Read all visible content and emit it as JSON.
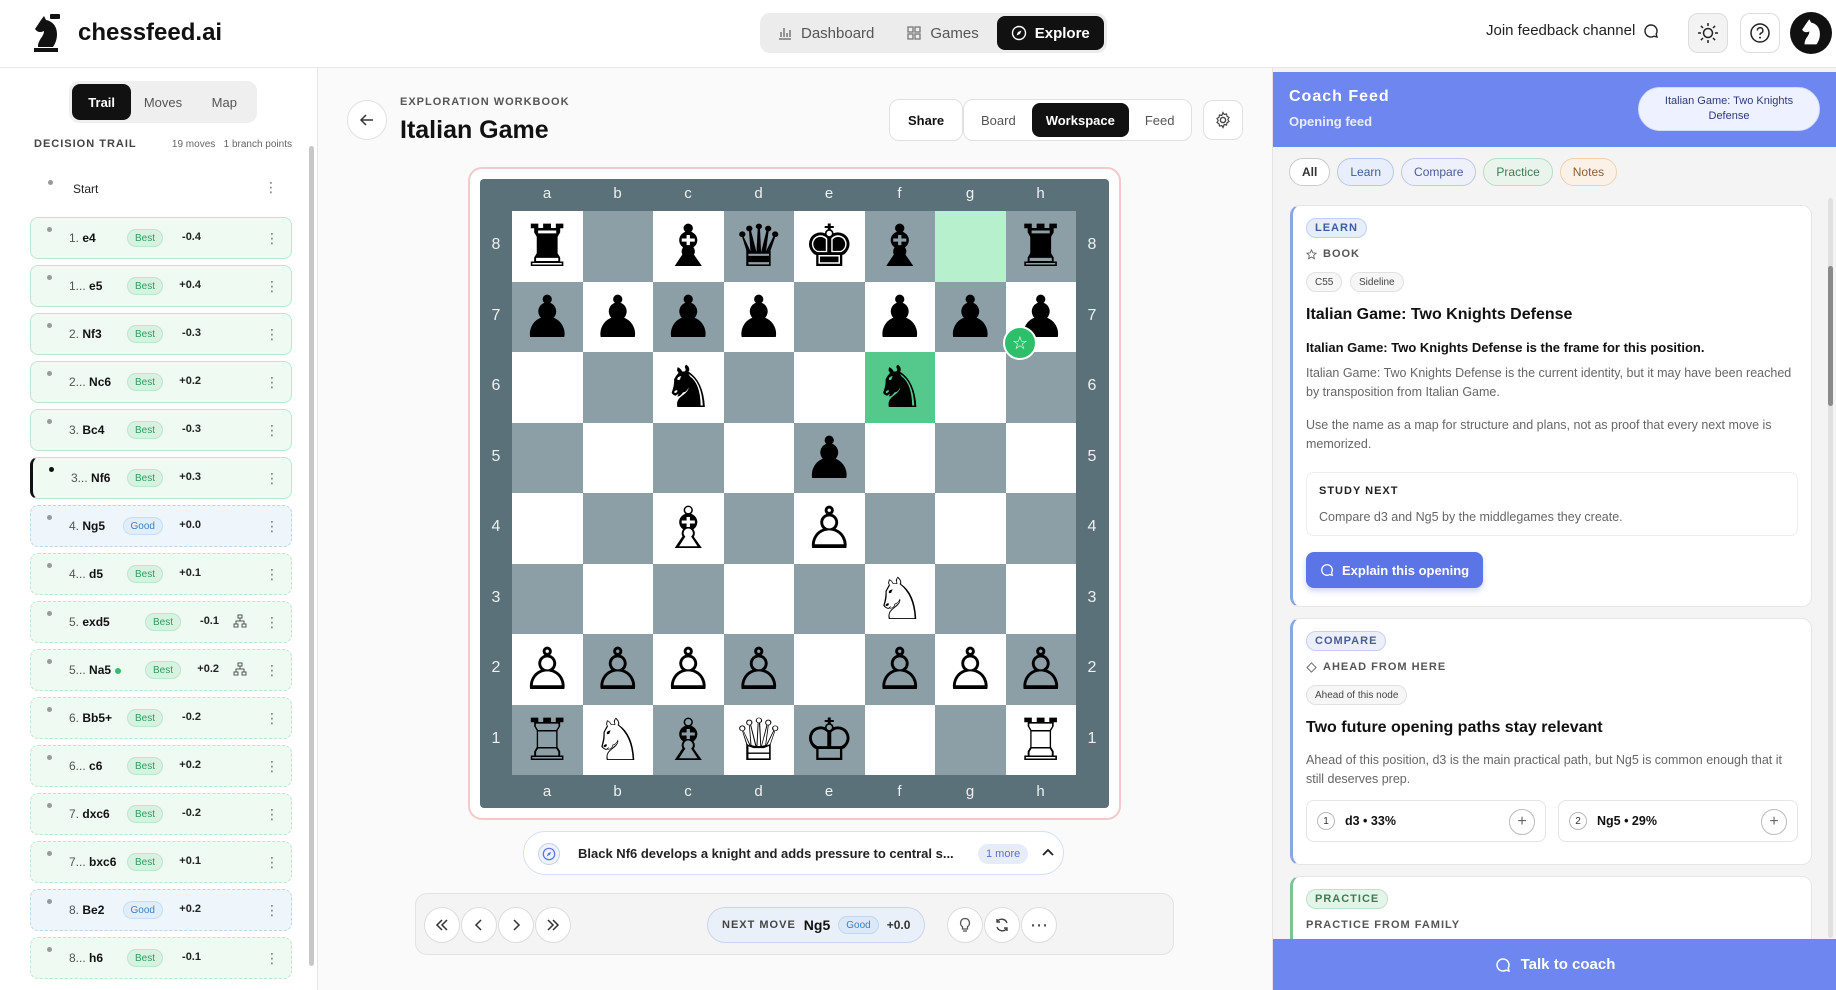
{
  "app": {
    "name": "chessfeed.ai"
  },
  "nav": {
    "items": [
      {
        "label": "Dashboard",
        "icon": "bar-chart-icon"
      },
      {
        "label": "Games",
        "icon": "grid-icon"
      },
      {
        "label": "Explore",
        "icon": "compass-icon"
      }
    ],
    "active": "Explore",
    "join": "Join feedback channel"
  },
  "left": {
    "tabs": [
      "Trail",
      "Moves",
      "Map"
    ],
    "active_tab": "Trail",
    "trail_title": "DECISION TRAIL",
    "moves_count": "19 moves",
    "branch_points": "1 branch points",
    "start": "Start",
    "moves": [
      {
        "num": "1.",
        "san": "e4",
        "badge": "Best",
        "eval": "-0.4",
        "type": "best"
      },
      {
        "num": "1...",
        "san": "e5",
        "badge": "Best",
        "eval": "+0.4",
        "type": "best"
      },
      {
        "num": "2.",
        "san": "Nf3",
        "badge": "Best",
        "eval": "-0.3",
        "type": "best"
      },
      {
        "num": "2...",
        "san": "Nc6",
        "badge": "Best",
        "eval": "+0.2",
        "type": "best"
      },
      {
        "num": "3.",
        "san": "Bc4",
        "badge": "Best",
        "eval": "-0.3",
        "type": "best"
      },
      {
        "num": "3...",
        "san": "Nf6",
        "badge": "Best",
        "eval": "+0.3",
        "type": "best",
        "current": true
      },
      {
        "num": "4.",
        "san": "Ng5",
        "badge": "Good",
        "eval": "+0.0",
        "type": "good"
      },
      {
        "num": "4...",
        "san": "d5",
        "badge": "Best",
        "eval": "+0.1",
        "type": "best",
        "dashed": true
      },
      {
        "num": "5.",
        "san": "exd5",
        "badge": "Best",
        "eval": "-0.1",
        "type": "best",
        "dashed": true,
        "branch": true
      },
      {
        "num": "5...",
        "san": "Na5",
        "badge": "Best",
        "eval": "+0.2",
        "type": "best",
        "dashed": true,
        "branch": true,
        "dot": true
      },
      {
        "num": "6.",
        "san": "Bb5+",
        "badge": "Best",
        "eval": "-0.2",
        "type": "best",
        "dashed": true
      },
      {
        "num": "6...",
        "san": "c6",
        "badge": "Best",
        "eval": "+0.2",
        "type": "best",
        "dashed": true
      },
      {
        "num": "7.",
        "san": "dxc6",
        "badge": "Best",
        "eval": "-0.2",
        "type": "best",
        "dashed": true
      },
      {
        "num": "7...",
        "san": "bxc6",
        "badge": "Best",
        "eval": "+0.1",
        "type": "best",
        "dashed": true
      },
      {
        "num": "8.",
        "san": "Be2",
        "badge": "Good",
        "eval": "+0.2",
        "type": "good"
      },
      {
        "num": "8...",
        "san": "h6",
        "badge": "Best",
        "eval": "-0.1",
        "type": "best",
        "dashed": true
      }
    ]
  },
  "center": {
    "eyebrow": "EXPLORATION WORKBOOK",
    "title": "Italian Game",
    "share": "Share",
    "view_tabs": [
      "Board",
      "Workspace",
      "Feed"
    ],
    "active_view": "Workspace",
    "files": [
      "a",
      "b",
      "c",
      "d",
      "e",
      "f",
      "g",
      "h"
    ],
    "ranks": [
      "8",
      "7",
      "6",
      "5",
      "4",
      "3",
      "2",
      "1"
    ],
    "board": [
      "r.bqkb.r",
      "pppp.ppp",
      "..n..n..",
      "....p...",
      "..B.P...",
      ".....N..",
      "PPPP.PPP",
      "RNBQK..R"
    ],
    "highlight_from": "g8",
    "highlight_to": "f6",
    "explanation": "Black Nf6 develops a knight and adds pressure to central s...",
    "explanation_more": "1 more",
    "next_label": "NEXT MOVE",
    "next_move": "Ng5",
    "next_badge": "Good",
    "next_eval": "+0.0"
  },
  "right": {
    "title": "Coach Feed",
    "subtitle": "Opening feed",
    "opening_pill": "Italian Game: Two Knights Defense",
    "filters": [
      "All",
      "Learn",
      "Compare",
      "Practice",
      "Notes"
    ],
    "learn": {
      "tag": "LEARN",
      "sub": "BOOK",
      "chips": [
        "C55",
        "Sideline"
      ],
      "title": "Italian Game: Two Knights Defense",
      "strong": "Italian Game: Two Knights Defense is the frame for this position.",
      "para1": "Italian Game: Two Knights Defense is the current identity, but it may have been reached by transposition from Italian Game.",
      "para2": "Use the name as a map for structure and plans, not as proof that every next move is memorized.",
      "study_label": "STUDY NEXT",
      "study_text": "Compare d3 and Ng5 by the middlegames they create.",
      "button": "Explain this opening"
    },
    "compare": {
      "tag": "COMPARE",
      "sub": "AHEAD FROM HERE",
      "chip": "Ahead of this node",
      "title": "Two future opening paths stay relevant",
      "para": "Ahead of this position, d3 is the main practical path, but Ng5 is common enough that it still deserves prep.",
      "paths": [
        {
          "num": "1",
          "text": "d3 • 33%"
        },
        {
          "num": "2",
          "text": "Ng5 • 29%"
        }
      ]
    },
    "practice": {
      "tag": "PRACTICE",
      "sub": "PRACTICE FROM FAMILY"
    },
    "talk": "Talk to coach"
  }
}
